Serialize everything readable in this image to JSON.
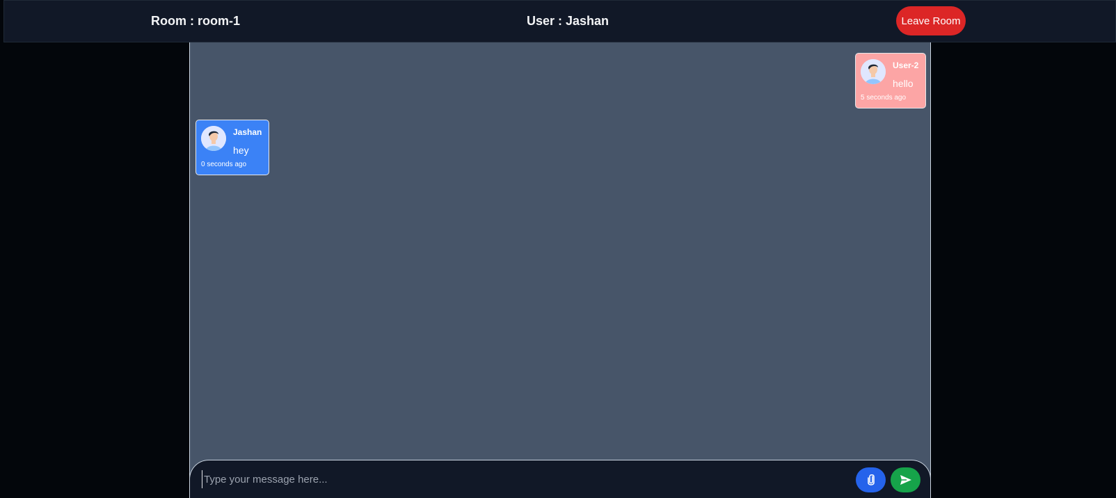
{
  "header": {
    "room_label": "Room : room-1",
    "user_label": "User : Jashan",
    "leave_button": "Leave Room"
  },
  "messages": [
    {
      "sender": "User-2",
      "text": "hello",
      "time": "5 seconds ago",
      "side": "right",
      "color": "#fca5a5"
    },
    {
      "sender": "Jashan",
      "text": "hey",
      "time": "0 seconds ago",
      "side": "left",
      "color": "#3b82f6"
    }
  ],
  "composer": {
    "placeholder": "Type your message here...",
    "value": "",
    "attach_icon": "paperclip-icon",
    "send_icon": "send-icon"
  },
  "colors": {
    "leave_button": "#dc2626",
    "attach_button": "#2563eb",
    "send_button": "#16a34a",
    "chat_background": "#475569",
    "header_background": "#111827"
  }
}
